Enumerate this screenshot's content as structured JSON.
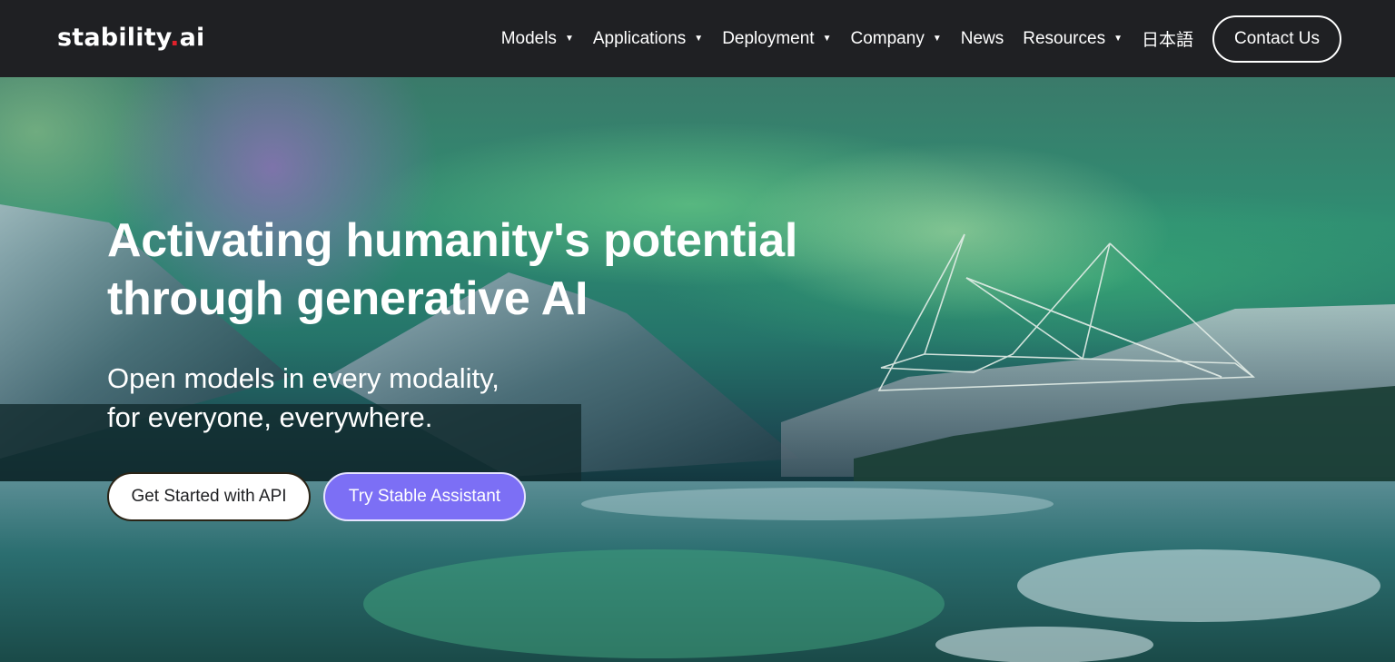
{
  "brand": {
    "name_main": "stability",
    "name_dot": ".",
    "name_suffix": "ai",
    "accent_dot_color": "#e0212b"
  },
  "nav": {
    "items": [
      {
        "label": "Models",
        "has_dropdown": true
      },
      {
        "label": "Applications",
        "has_dropdown": true
      },
      {
        "label": "Deployment",
        "has_dropdown": true
      },
      {
        "label": "Company",
        "has_dropdown": true
      },
      {
        "label": "News",
        "has_dropdown": false
      },
      {
        "label": "Resources",
        "has_dropdown": true
      },
      {
        "label": "日本語",
        "has_dropdown": false
      }
    ],
    "dropdown_glyph": "▼",
    "contact_label": "Contact Us"
  },
  "hero": {
    "headline_line1": "Activating humanity's potential",
    "headline_line2": "through generative AI",
    "subhead_line1": "Open models in every modality,",
    "subhead_line2": "for everyone, everywhere.",
    "primary_button": "Get Started with API",
    "secondary_button": "Try Stable Assistant",
    "secondary_button_color": "#7c6ff5",
    "background_image": "aurora-over-mountain-lake",
    "decoration": "wireframe-pyramids-icon"
  }
}
